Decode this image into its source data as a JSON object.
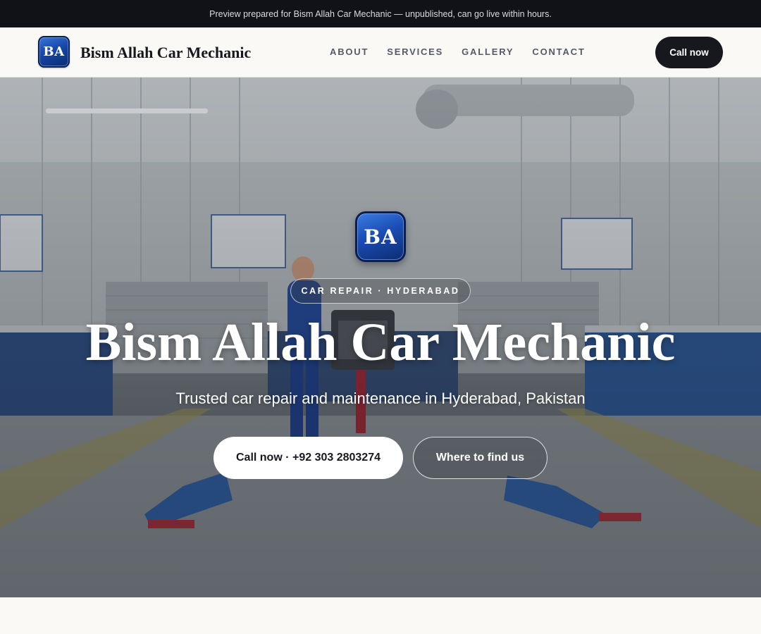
{
  "topbar": {
    "notice": "Preview prepared for Bism Allah Car Mechanic — unpublished, can go live within hours."
  },
  "navbar": {
    "logo_initials": "BA",
    "brand_name": "Bism Allah Car Mechanic",
    "links": [
      {
        "label": "ABOUT"
      },
      {
        "label": "SERVICES"
      },
      {
        "label": "GALLERY"
      },
      {
        "label": "CONTACT"
      }
    ],
    "cta_label": "Call now"
  },
  "hero": {
    "logo_initials": "BA",
    "badge": "CAR REPAIR · HYDERABAD",
    "title": "Bism Allah Car Mechanic",
    "subtitle": "Trusted car repair and maintenance in Hyderabad, Pakistan",
    "primary_button": "Call now · +92 303 2803274",
    "secondary_button": "Where to find us"
  },
  "colors": {
    "dark": "#16181d",
    "brand_blue": "#1a4db4",
    "background": "#faf9f6"
  }
}
